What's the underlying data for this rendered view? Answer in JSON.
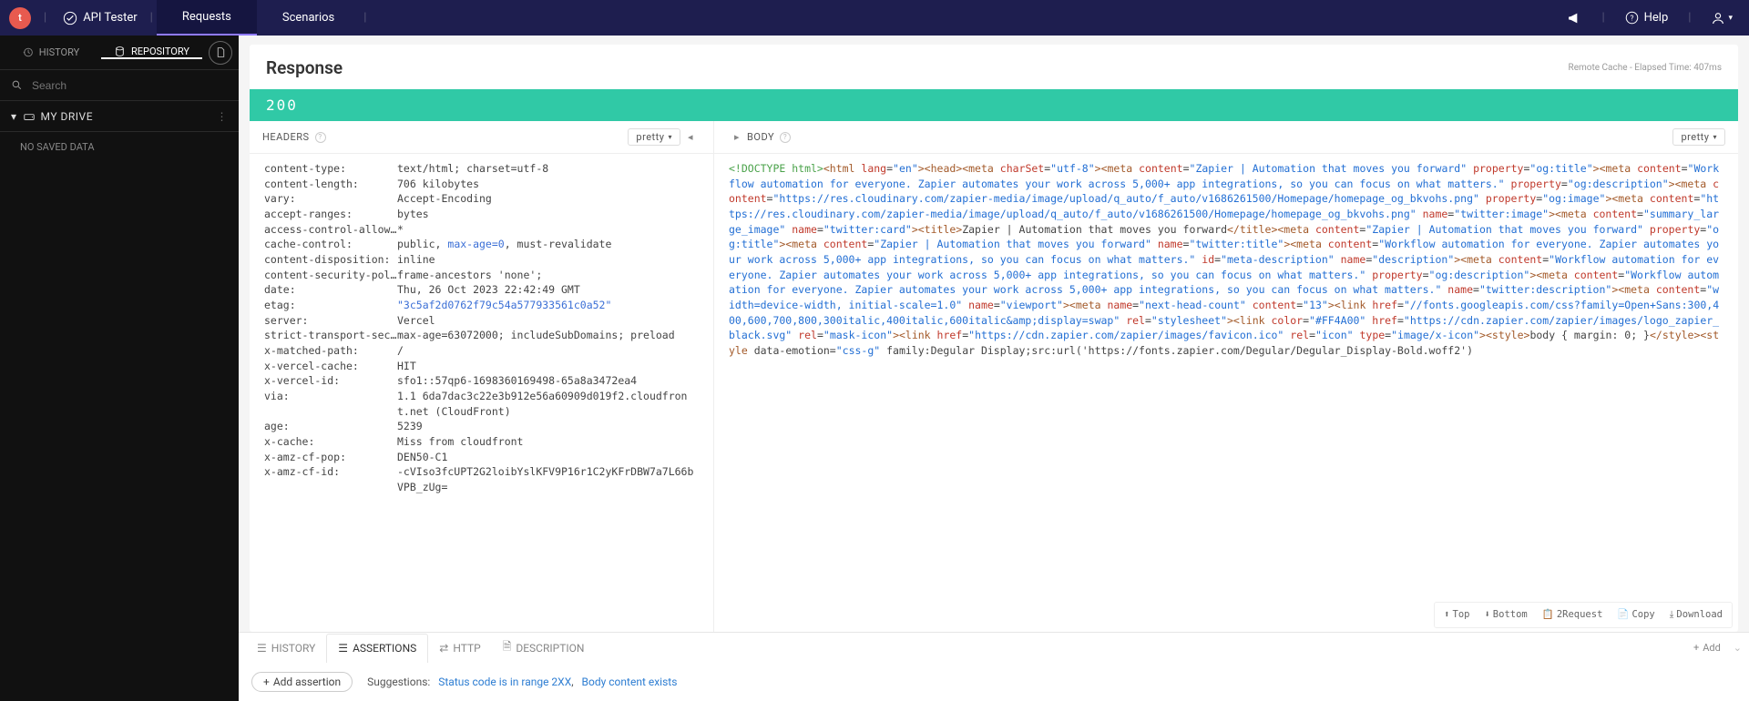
{
  "topbar": {
    "app": "API Tester",
    "tabs": [
      "Requests",
      "Scenarios"
    ],
    "active_tab": 0,
    "help": "Help"
  },
  "sidebar": {
    "tabs": {
      "history": "HISTORY",
      "repository": "REPOSITORY"
    },
    "active": "repository",
    "search_placeholder": "Search",
    "drive": "MY DRIVE",
    "empty": "NO SAVED DATA"
  },
  "response": {
    "title": "Response",
    "cache": "Remote Cache",
    "elapsed": "Elapsed Time: 407ms",
    "status": "200"
  },
  "headers_panel": {
    "title": "HEADERS",
    "pretty": "pretty",
    "items": [
      {
        "name": "content-type:",
        "value": "text/html; charset=utf-8"
      },
      {
        "name": "content-length:",
        "value": "706 kilobytes"
      },
      {
        "name": "vary:",
        "value": "Accept-Encoding"
      },
      {
        "name": "accept-ranges:",
        "value": "bytes"
      },
      {
        "name": "access-control-allow-o…",
        "value": "*"
      },
      {
        "name": "cache-control:",
        "value": "public, ",
        "link": "max-age=0",
        "after": ", must-revalidate"
      },
      {
        "name": "content-disposition:",
        "value": "inline"
      },
      {
        "name": "content-security-polic…",
        "value": "frame-ancestors 'none';"
      },
      {
        "name": "date:",
        "value": "Thu, 26 Oct 2023 22:42:49 GMT"
      },
      {
        "name": "etag:",
        "value": "",
        "link": "\"3c5af2d0762f79c54a577933561c0a52\""
      },
      {
        "name": "server:",
        "value": "Vercel"
      },
      {
        "name": "strict-transport-secur…",
        "value": "max-age=63072000; includeSubDomains; preload"
      },
      {
        "name": "x-matched-path:",
        "value": "/"
      },
      {
        "name": "x-vercel-cache:",
        "value": "HIT"
      },
      {
        "name": "x-vercel-id:",
        "value": "sfo1::57qp6-1698360169498-65a8a3472ea4"
      },
      {
        "name": "via:",
        "value": "1.1 6da7dac3c22e3b912e56a60909d019f2.cloudfront.net (CloudFront)"
      },
      {
        "name": "age:",
        "value": "5239"
      },
      {
        "name": "x-cache:",
        "value": "Miss from cloudfront"
      },
      {
        "name": "x-amz-cf-pop:",
        "value": "DEN50-C1"
      },
      {
        "name": "x-amz-cf-id:",
        "value": "-cVIso3fcUPT2G2loibYslKFV9P16r1C2yKFrDBW7a7L66bVPB_zUg="
      }
    ]
  },
  "body_panel": {
    "title": "BODY",
    "pretty": "pretty",
    "tokens": [
      {
        "c": "grn",
        "t": "<!DOCTYPE html>"
      },
      {
        "c": "brn",
        "t": "<html"
      },
      {
        "c": "red",
        "t": " lang"
      },
      {
        "c": "",
        "t": "="
      },
      {
        "c": "blu",
        "t": "\"en\""
      },
      {
        "c": "brn",
        "t": "><head><meta"
      },
      {
        "c": "red",
        "t": " charSet"
      },
      {
        "c": "",
        "t": "="
      },
      {
        "c": "blu",
        "t": "\"utf-8\""
      },
      {
        "c": "brn",
        "t": "><meta"
      },
      {
        "c": "red",
        "t": " content"
      },
      {
        "c": "",
        "t": "="
      },
      {
        "c": "blu",
        "t": "\"Zapier | Automation that moves you forward\""
      },
      {
        "c": "red",
        "t": " property"
      },
      {
        "c": "",
        "t": "="
      },
      {
        "c": "blu",
        "t": "\"og:title\""
      },
      {
        "c": "brn",
        "t": "><meta"
      },
      {
        "c": "red",
        "t": " content"
      },
      {
        "c": "",
        "t": "="
      },
      {
        "c": "blu",
        "t": "\"Workflow automation for everyone. Zapier automates your work across 5,000+ app integrations, so you can focus on what matters.\""
      },
      {
        "c": "red",
        "t": " property"
      },
      {
        "c": "",
        "t": "="
      },
      {
        "c": "blu",
        "t": "\"og:description\""
      },
      {
        "c": "brn",
        "t": "><meta"
      },
      {
        "c": "red",
        "t": " content"
      },
      {
        "c": "",
        "t": "="
      },
      {
        "c": "blu",
        "t": "\"https://res.cloudinary.com/zapier-media/image/upload/q_auto/f_auto/v1686261500/Homepage/homepage_og_bkvohs.png\""
      },
      {
        "c": "red",
        "t": " property"
      },
      {
        "c": "",
        "t": "="
      },
      {
        "c": "blu",
        "t": "\"og:image\""
      },
      {
        "c": "brn",
        "t": "><meta"
      },
      {
        "c": "red",
        "t": " content"
      },
      {
        "c": "",
        "t": "="
      },
      {
        "c": "blu",
        "t": "\"https://res.cloudinary.com/zapier-media/image/upload/q_auto/f_auto/v1686261500/Homepage/homepage_og_bkvohs.png\""
      },
      {
        "c": "red",
        "t": " name"
      },
      {
        "c": "",
        "t": "="
      },
      {
        "c": "blu",
        "t": "\"twitter:image\""
      },
      {
        "c": "brn",
        "t": "><meta"
      },
      {
        "c": "red",
        "t": " content"
      },
      {
        "c": "",
        "t": "="
      },
      {
        "c": "blu",
        "t": "\"summary_large_image\""
      },
      {
        "c": "red",
        "t": " name"
      },
      {
        "c": "",
        "t": "="
      },
      {
        "c": "blu",
        "t": "\"twitter:card\""
      },
      {
        "c": "brn",
        "t": "><title>"
      },
      {
        "c": "",
        "t": "Zapier | Automation that moves you forward"
      },
      {
        "c": "brn",
        "t": "</title><meta"
      },
      {
        "c": "red",
        "t": " content"
      },
      {
        "c": "",
        "t": "="
      },
      {
        "c": "blu",
        "t": "\"Zapier | Automation that moves you forward\""
      },
      {
        "c": "red",
        "t": " property"
      },
      {
        "c": "",
        "t": "="
      },
      {
        "c": "blu",
        "t": "\"og:title\""
      },
      {
        "c": "brn",
        "t": "><meta"
      },
      {
        "c": "red",
        "t": " content"
      },
      {
        "c": "",
        "t": "="
      },
      {
        "c": "blu",
        "t": "\"Zapier | Automation that moves you forward\""
      },
      {
        "c": "red",
        "t": " name"
      },
      {
        "c": "",
        "t": "="
      },
      {
        "c": "blu",
        "t": "\"twitter:title\""
      },
      {
        "c": "brn",
        "t": "><meta"
      },
      {
        "c": "red",
        "t": " content"
      },
      {
        "c": "",
        "t": "="
      },
      {
        "c": "blu",
        "t": "\"Workflow automation for everyone. Zapier automates your work across 5,000+ app integrations, so you can focus on what matters.\""
      },
      {
        "c": "red",
        "t": " id"
      },
      {
        "c": "",
        "t": "="
      },
      {
        "c": "blu",
        "t": "\"meta-description\""
      },
      {
        "c": "red",
        "t": " name"
      },
      {
        "c": "",
        "t": "="
      },
      {
        "c": "blu",
        "t": "\"description\""
      },
      {
        "c": "brn",
        "t": "><meta"
      },
      {
        "c": "red",
        "t": " content"
      },
      {
        "c": "",
        "t": "="
      },
      {
        "c": "blu",
        "t": "\"Workflow automation for everyone. Zapier automates your work across 5,000+ app integrations, so you can focus on what matters.\""
      },
      {
        "c": "red",
        "t": " property"
      },
      {
        "c": "",
        "t": "="
      },
      {
        "c": "blu",
        "t": "\"og:description\""
      },
      {
        "c": "brn",
        "t": "><meta"
      },
      {
        "c": "red",
        "t": " content"
      },
      {
        "c": "",
        "t": "="
      },
      {
        "c": "blu",
        "t": "\"Workflow automation for everyone. Zapier automates your work across 5,000+ app integrations, so you can focus on what matters.\""
      },
      {
        "c": "red",
        "t": " name"
      },
      {
        "c": "",
        "t": "="
      },
      {
        "c": "blu",
        "t": "\"twitter:description\""
      },
      {
        "c": "brn",
        "t": "><meta"
      },
      {
        "c": "red",
        "t": " content"
      },
      {
        "c": "",
        "t": "="
      },
      {
        "c": "blu",
        "t": "\"width=device-width, initial-scale=1.0\""
      },
      {
        "c": "red",
        "t": " name"
      },
      {
        "c": "",
        "t": "="
      },
      {
        "c": "blu",
        "t": "\"viewport\""
      },
      {
        "c": "brn",
        "t": "><meta"
      },
      {
        "c": "red",
        "t": " name"
      },
      {
        "c": "",
        "t": "="
      },
      {
        "c": "blu",
        "t": "\"next-head-count\""
      },
      {
        "c": "red",
        "t": " content"
      },
      {
        "c": "",
        "t": "="
      },
      {
        "c": "blu",
        "t": "\"13\""
      },
      {
        "c": "brn",
        "t": "><link"
      },
      {
        "c": "red",
        "t": " href"
      },
      {
        "c": "",
        "t": "="
      },
      {
        "c": "blu",
        "t": "\"//fonts.googleapis.com/css?family=Open+Sans:300,400,600,700,800,300italic,400italic,600italic&amp;display=swap\""
      },
      {
        "c": "red",
        "t": " rel"
      },
      {
        "c": "",
        "t": "="
      },
      {
        "c": "blu",
        "t": "\"stylesheet\""
      },
      {
        "c": "brn",
        "t": "><link"
      },
      {
        "c": "red",
        "t": " color"
      },
      {
        "c": "",
        "t": "="
      },
      {
        "c": "blu",
        "t": "\"#FF4A00\""
      },
      {
        "c": "red",
        "t": " href"
      },
      {
        "c": "",
        "t": "="
      },
      {
        "c": "blu",
        "t": "\"https://cdn.zapier.com/zapier/images/logo_zapier_black.svg\""
      },
      {
        "c": "red",
        "t": " rel"
      },
      {
        "c": "",
        "t": "="
      },
      {
        "c": "blu",
        "t": "\"mask-icon\""
      },
      {
        "c": "brn",
        "t": "><link"
      },
      {
        "c": "red",
        "t": " href"
      },
      {
        "c": "",
        "t": "="
      },
      {
        "c": "blu",
        "t": "\"https://cdn.zapier.com/zapier/images/favicon.ico\""
      },
      {
        "c": "red",
        "t": " rel"
      },
      {
        "c": "",
        "t": "="
      },
      {
        "c": "blu",
        "t": "\"icon\""
      },
      {
        "c": "red",
        "t": " type"
      },
      {
        "c": "",
        "t": "="
      },
      {
        "c": "blu",
        "t": "\"image/x-icon\""
      },
      {
        "c": "brn",
        "t": "><style>"
      },
      {
        "c": "",
        "t": "body { margin: 0; }"
      },
      {
        "c": "brn",
        "t": "</style><style"
      },
      {
        "c": "",
        "t": " data-emotion="
      },
      {
        "c": "blu",
        "t": "\"css-g\""
      },
      {
        "c": "",
        "t": " family:Degular Display;src:url('https://fonts.zapier.com/Degular/Degular_Display-Bold.woff2')"
      }
    ],
    "actions": {
      "top": "Top",
      "bottom": "Bottom",
      "req": "2Request",
      "copy": "Copy",
      "download": "Download"
    }
  },
  "bottom": {
    "tabs": {
      "history": "HISTORY",
      "assertions": "ASSERTIONS",
      "http": "HTTP",
      "description": "DESCRIPTION"
    },
    "add": "Add",
    "add_assertion": "Add assertion",
    "sugg_label": "Suggestions:",
    "sugg1": "Status code is in range 2XX",
    "sugg2": "Body content exists"
  }
}
